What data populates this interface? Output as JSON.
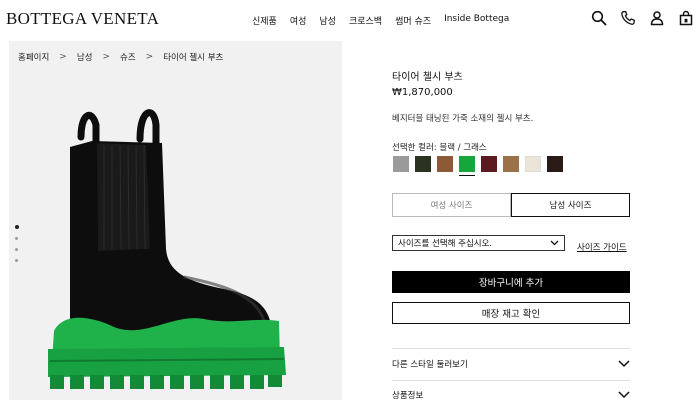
{
  "brand": {
    "logo_text": "BOTTEGA VENETA"
  },
  "nav": {
    "items": [
      "신제품",
      "여성",
      "남성",
      "크로스백",
      "썸머 슈즈",
      "Inside Bottega"
    ]
  },
  "header_icons": [
    "search-icon",
    "phone-icon",
    "account-icon",
    "bag-icon"
  ],
  "breadcrumb": {
    "items": [
      "홈페이지",
      "남성",
      "슈즈",
      "타이어 첼시 부츠"
    ],
    "separator": ">"
  },
  "gallery": {
    "image_count": 4,
    "active_index": 0
  },
  "product": {
    "title": "타이어 첼시 부츠",
    "price": "₩1,870,000",
    "description": "베지터블 태닝된 가죽 소재의 첼시 부츠.",
    "color_label": "선택한 컬러: 블랙 / 그래스",
    "colors": [
      "#9a9a9a",
      "#2b3320",
      "#8c5a36",
      "#16a73c",
      "#5b1a1f",
      "#9c7048",
      "#ece4d8",
      "#2a1a18"
    ],
    "selected_color_index": 3
  },
  "size": {
    "toggle": [
      "여성 사이즈",
      "남성 사이즈"
    ],
    "active_toggle_index": 1,
    "select_placeholder": "사이즈를 선택해 주십시오.",
    "guide_label": "사이즈 가이드"
  },
  "actions": {
    "add_to_cart": "장바구니에 추가",
    "store_stock": "매장 재고 확인"
  },
  "accordions": [
    "다른 스타일 둘러보기",
    "상품정보"
  ],
  "colors": {
    "boot_leather": "#0d0d0d",
    "sole_green": "#1fb14a",
    "panel_bg": "#f1f1f1"
  }
}
